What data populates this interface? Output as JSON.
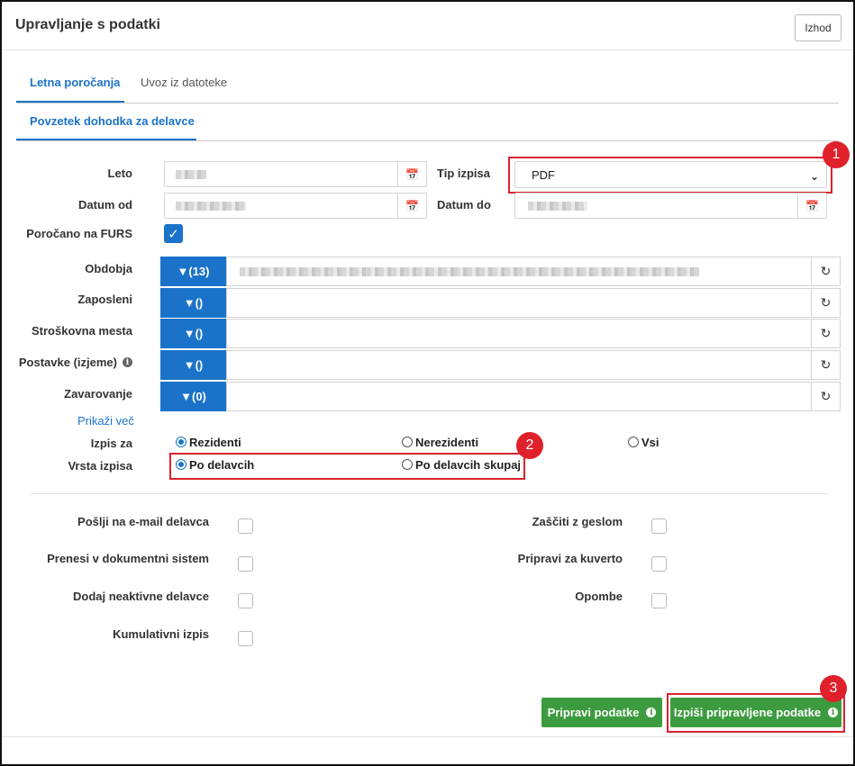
{
  "header": {
    "title": "Upravljanje s podatki",
    "exit_label": "Izhod"
  },
  "tabs": [
    {
      "label": "Letna poročanja",
      "active": true
    },
    {
      "label": "Uvoz iz datoteke",
      "active": false
    }
  ],
  "subtab": {
    "label": "Povzetek dohodka za delavce"
  },
  "form": {
    "leto_label": "Leto",
    "datum_od_label": "Datum od",
    "tip_izpisa_label": "Tip izpisa",
    "tip_izpisa_value": "PDF",
    "datum_do_label": "Datum do",
    "porocano_label": "Poročano na FURS"
  },
  "filters": [
    {
      "label": "Obdobja",
      "button": "(13)"
    },
    {
      "label": "Zaposleni",
      "button": "()"
    },
    {
      "label": "Stroškovna mesta",
      "button": "()"
    },
    {
      "label": "Postavke (izjeme)",
      "button": "()"
    },
    {
      "label": "Zavarovanje",
      "button": "(0)"
    }
  ],
  "show_more": "Prikaži več",
  "izpis_za": {
    "label": "Izpis za",
    "options": [
      "Rezidenti",
      "Nerezidenti",
      "Vsi"
    ],
    "selected": "Rezidenti"
  },
  "vrsta_izpisa": {
    "label": "Vrsta izpisa",
    "options": [
      "Po delavcih",
      "Po delavcih skupaj"
    ],
    "selected": "Po delavcih"
  },
  "checkboxes_left": [
    "Pošlji na e-mail delavca",
    "Prenesi v dokumentni sistem",
    "Dodaj neaktivne delavce",
    "Kumulativni izpis"
  ],
  "checkboxes_right": [
    "Zaščiti z geslom",
    "Pripravi za kuverto",
    "Opombe"
  ],
  "buttons": {
    "prepare": "Pripravi podatke",
    "print_prepared": "Izpiši pripravljene podatke"
  },
  "badges": [
    "1",
    "2",
    "3"
  ],
  "icons": {
    "calendar": "calendar-icon",
    "filter": "filter-icon",
    "refresh": "refresh-icon",
    "info": "info-icon",
    "chevron": "chevron-down-icon",
    "check": "check-icon"
  },
  "colors": {
    "primary": "#1a73c9",
    "success": "#3c9b3e",
    "highlight": "#d9232e"
  }
}
